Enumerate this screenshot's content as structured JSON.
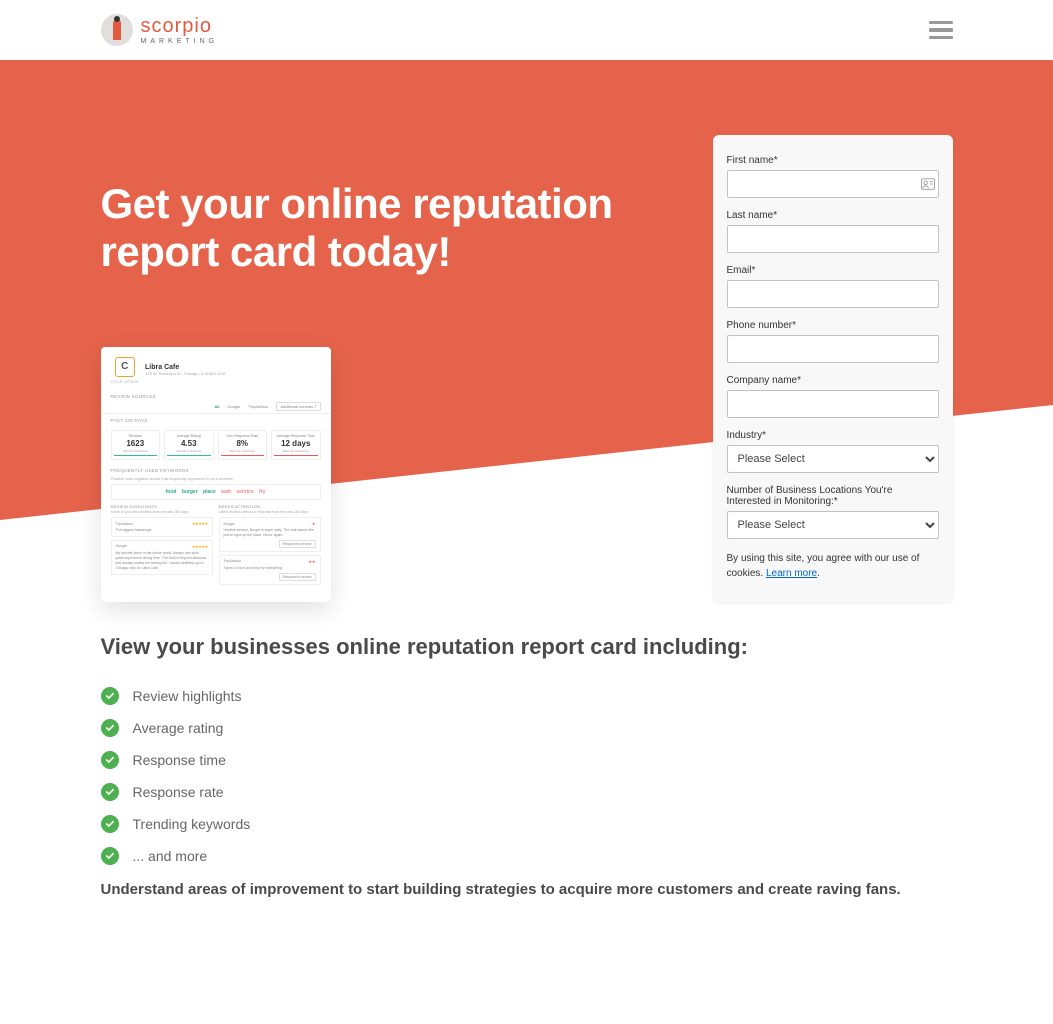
{
  "header": {
    "logo_name": "scorpio",
    "logo_sub": "MARKETING"
  },
  "hero": {
    "title": "Get your online reputation report card today!"
  },
  "form": {
    "first_name_label": "First name*",
    "last_name_label": "Last name*",
    "email_label": "Email*",
    "phone_label": "Phone number*",
    "company_label": "Company name*",
    "industry_label": "Industry*",
    "industry_placeholder": "Please Select",
    "locations_label": "Number of Business Locations You're Interested in Monitoring:*",
    "locations_placeholder": "Please Select",
    "cookie_text": "By using this site, you agree with our use of cookies. ",
    "cookie_link": "Learn more"
  },
  "mock": {
    "grade": "C",
    "grade_label": "YOUR GRADE",
    "biz_name": "Libra Cafe",
    "biz_addr": "123 W. Randolph St., Chicago, IL 60601 USA",
    "sources_label": "REVIEW SOURCES",
    "src_all": "All",
    "src_google": "Google",
    "src_trip": "TripAdvisor",
    "src_addl": "Additional sources 7",
    "past_label": "PAST 180 DAYS",
    "stats": [
      {
        "label": "Reviews",
        "value": "1623",
        "sub": "ABOVE AVERAGE",
        "bar": "g"
      },
      {
        "label": "Average Rating",
        "value": "4.53",
        "sub": "ABOVE AVERAGE",
        "bar": "g"
      },
      {
        "label": "Your Response Rate",
        "value": "8%",
        "sub": "BELOW AVERAGE",
        "bar": "r"
      },
      {
        "label": "Average Response Time",
        "value": "12 days",
        "sub": "BELOW AVERAGE",
        "bar": "r"
      }
    ],
    "keywords_label": "FREQUENTLY USED KEYWORDS",
    "keywords_sub": "Positive and negative words that frequently appeared in your reviews",
    "keywords": [
      {
        "text": "food",
        "cls": "kw-g"
      },
      {
        "text": "burger",
        "cls": "kw-g"
      },
      {
        "text": "place",
        "cls": "kw-g"
      },
      {
        "text": "wait",
        "cls": "kw-o"
      },
      {
        "text": "service",
        "cls": "kw-o"
      },
      {
        "text": "fry",
        "cls": "kw-o"
      }
    ],
    "highlights_label": "REVIEW HIGHLIGHTS",
    "highlights_sub": "Some of your best reviews from the past 180 days",
    "attention_label": "NEEDS ATTENTION",
    "attention_sub": "Latest reviews without a response from the past 180 days",
    "review_tripadvisor": "TripAdvisor",
    "review_google": "Google",
    "rev1_text": "The biggest hamburger",
    "rev2_text": "My favorite place in the whole world. Always had such great experience dining here. The food is beyond delicious, and always makes me feeling full. I would definitely go to Chicago only for Libra Cafe.",
    "rev3_text": "Horrible service. Burger is super salty. The wait seems like just to hype up the place. Never again.",
    "rev4_text": "Spent 3 hours and they fry everything.",
    "respond_btn": "Respond to review"
  },
  "below": {
    "title": "View your businesses online reputation report card including:",
    "items": [
      "Review highlights",
      "Average rating",
      "Response time",
      "Response rate",
      "Trending keywords",
      "... and more"
    ],
    "para": "Understand areas of improvement to start building strategies to acquire more customers and create raving fans."
  }
}
